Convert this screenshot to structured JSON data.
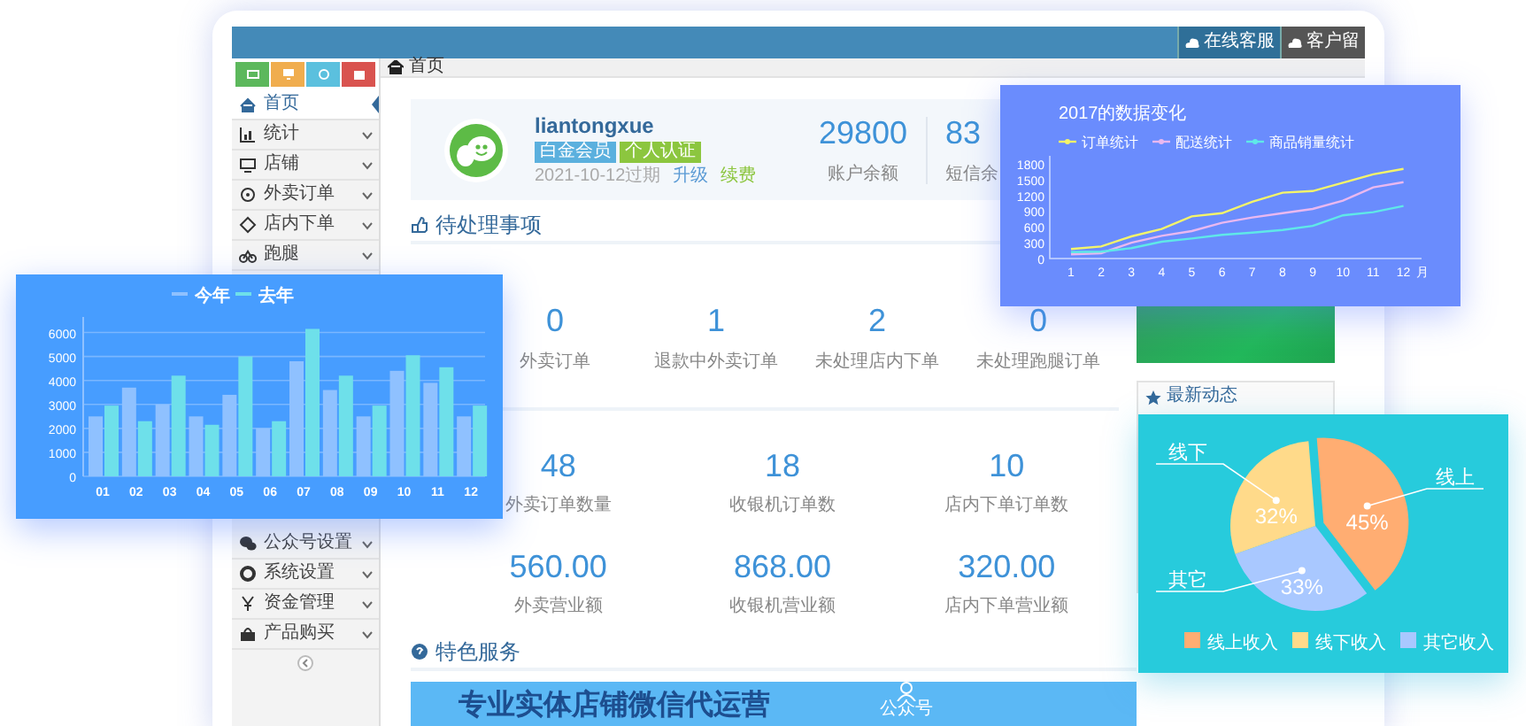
{
  "header": {
    "buttons": [
      {
        "label": "在线客服"
      },
      {
        "label": "客户留"
      }
    ]
  },
  "sidebar": {
    "shortcuts": [
      {
        "color": "#5cb85c"
      },
      {
        "color": "#f0ad4e"
      },
      {
        "color": "#5bc0de"
      },
      {
        "color": "#d9534f"
      }
    ],
    "items": [
      {
        "label": "首页",
        "selected": true,
        "has_submenu": false
      },
      {
        "label": "统计",
        "selected": false,
        "has_submenu": true
      },
      {
        "label": "店铺",
        "selected": false,
        "has_submenu": true
      },
      {
        "label": "外卖订单",
        "selected": false,
        "has_submenu": true
      },
      {
        "label": "店内下单",
        "selected": false,
        "has_submenu": true
      },
      {
        "label": "跑腿",
        "selected": false,
        "has_submenu": true
      }
    ],
    "lower_items": [
      {
        "label": "公众号设置",
        "selected": false,
        "has_submenu": true
      },
      {
        "label": "系统设置",
        "selected": false,
        "has_submenu": true
      },
      {
        "label": "资金管理",
        "selected": false,
        "has_submenu": true
      },
      {
        "label": "产品购买",
        "selected": false,
        "has_submenu": true
      }
    ]
  },
  "breadcrumb": "首页",
  "profile": {
    "username": "liantongxue",
    "badges": [
      {
        "label": "白金会员",
        "color": "#5bb0de"
      },
      {
        "label": "个人认证",
        "color": "#8cc63f"
      }
    ],
    "expiry": "2021-10-12过期",
    "links": [
      {
        "label": "升级",
        "color": "#5b9bd5"
      },
      {
        "label": "续费",
        "color": "#8cc63f"
      }
    ],
    "stats": [
      {
        "value": "29800",
        "label": "账户余额"
      },
      {
        "value": "83",
        "label": "短信余"
      }
    ]
  },
  "pending": {
    "title": "待处理事项",
    "items": [
      {
        "value": "0",
        "label": "外卖订单"
      },
      {
        "value": "1",
        "label": "退款中外卖订单"
      },
      {
        "value": "2",
        "label": "未处理店内下单"
      },
      {
        "value": "0",
        "label": "未处理跑腿订单"
      }
    ]
  },
  "counts": [
    {
      "value": "48",
      "label": "外卖订单数量"
    },
    {
      "value": "18",
      "label": "收银机订单数"
    },
    {
      "value": "10",
      "label": "店内下单订单数"
    }
  ],
  "revenue": [
    {
      "value": "560.00",
      "label": "外卖营业额"
    },
    {
      "value": "868.00",
      "label": "收银机营业额"
    },
    {
      "value": "320.00",
      "label": "店内下单营业额"
    }
  ],
  "news": {
    "title": "最新动态"
  },
  "services": {
    "title": "特色服务",
    "banner_title": "专业实体店铺微信代运营",
    "banner_icon_label": "公众号"
  },
  "bar_chart": {
    "chart_data": {
      "type": "bar",
      "grid": true,
      "legend": true,
      "categories": [
        "01",
        "02",
        "03",
        "04",
        "05",
        "06",
        "07",
        "08",
        "09",
        "10",
        "11",
        "12"
      ],
      "ylim": [
        0,
        6500
      ],
      "yticks": [
        0,
        1000,
        2000,
        3000,
        4000,
        5000,
        6000
      ],
      "series": [
        {
          "name": "今年",
          "color": "#8fc1ff",
          "values": [
            2500,
            3700,
            3000,
            2500,
            3400,
            2000,
            4800,
            3600,
            2500,
            4400,
            3900,
            2500
          ]
        },
        {
          "name": "去年",
          "color": "#6ee0ea",
          "values": [
            2950,
            2300,
            4200,
            2150,
            5000,
            2300,
            6150,
            4200,
            2950,
            5050,
            4550,
            2950
          ]
        }
      ]
    }
  },
  "line_chart": {
    "chart_data": {
      "type": "line",
      "title": "2017的数据变化",
      "legend": true,
      "xlabel": "月",
      "x": [
        1,
        2,
        3,
        4,
        5,
        6,
        7,
        8,
        9,
        10,
        11,
        12
      ],
      "xlim": [
        0.3,
        12.6
      ],
      "xticks": [
        1,
        2,
        3,
        4,
        5,
        6,
        7,
        8,
        9,
        10,
        11,
        12
      ],
      "ylim": [
        0,
        1950
      ],
      "yticks": [
        0,
        300,
        600,
        900,
        1200,
        1500,
        1800
      ],
      "series": [
        {
          "name": "订单统计",
          "color": "#f4f46a",
          "values": [
            180,
            230,
            420,
            560,
            800,
            860,
            1080,
            1250,
            1280,
            1440,
            1600,
            1700
          ]
        },
        {
          "name": "配送统计",
          "color": "#e9b8f0",
          "values": [
            80,
            100,
            300,
            430,
            520,
            680,
            780,
            860,
            940,
            1100,
            1350,
            1450
          ]
        },
        {
          "name": "商品销量统计",
          "color": "#5fe8e8",
          "values": [
            120,
            130,
            200,
            320,
            380,
            450,
            490,
            540,
            620,
            820,
            880,
            1000
          ]
        }
      ]
    }
  },
  "pie_chart": {
    "slice_colors": [
      {
        "color": "#ffad72"
      },
      {
        "color": "#ffda8a"
      },
      {
        "color": "#a9c8ff"
      }
    ],
    "chart_data": {
      "type": "pie",
      "legend": true,
      "categories": [
        "线上收入",
        "线下收入",
        "其它收入"
      ],
      "values": [
        45,
        32,
        33
      ],
      "value_labels": [
        "45%",
        "32%",
        "33%"
      ],
      "annotations": [
        {
          "text": "线上"
        },
        {
          "text": "线下"
        },
        {
          "text": "其它"
        }
      ]
    }
  }
}
